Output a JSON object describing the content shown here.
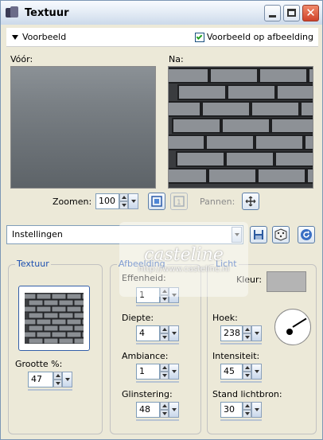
{
  "window": {
    "title": "Textuur"
  },
  "preview": {
    "toggle_label": "Voorbeeld",
    "image_preview_label": "Voorbeeld op afbeelding",
    "image_preview_checked": true,
    "before_label": "Vóór:",
    "after_label": "Na:"
  },
  "zoom": {
    "label": "Zoomen:",
    "value": "100",
    "pan_label": "Pannen:"
  },
  "settings": {
    "value": "Instellingen"
  },
  "texture_group": {
    "title": "Textuur",
    "size_label": "Grootte %:",
    "size_value": "47"
  },
  "image_group": {
    "title": "Afbeelding",
    "smoothness_label": "Effenheid:",
    "smoothness_value": "1",
    "depth_label": "Diepte:",
    "depth_value": "4",
    "ambiance_label": "Ambiance:",
    "ambiance_value": "1",
    "shininess_label": "Glinstering:",
    "shininess_value": "48"
  },
  "light_group": {
    "title": "Licht",
    "color_label": "Kleur:",
    "color_value": "#b4b4b4",
    "angle_label": "Hoek:",
    "angle_value": "238",
    "intensity_label": "Intensiteit:",
    "intensity_value": "45",
    "elevation_label": "Stand lichtbron:",
    "elevation_value": "30"
  },
  "watermark": {
    "text_main": "casteline",
    "text_url": "http://www.casteline.nl"
  }
}
